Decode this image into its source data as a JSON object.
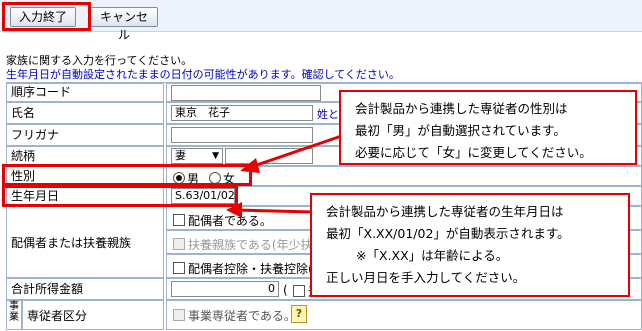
{
  "toolbar": {
    "end_label": "入力終了",
    "cancel_label": "キャンセル"
  },
  "messages": {
    "info": "家族に関する入力を行ってください。",
    "warning": "生年月日が自動設定されたままの日付の可能性があります。確認してください。"
  },
  "fields": {
    "order_code": {
      "label": "順序コード",
      "value": ""
    },
    "name": {
      "label": "氏名",
      "value": "東京　花子",
      "link": "姓と名の"
    },
    "furigana": {
      "label": "フリガナ",
      "value": ""
    },
    "relation": {
      "label": "続柄",
      "value": "妻"
    },
    "gender": {
      "label": "性別",
      "options": [
        "男",
        "女"
      ],
      "selected": "男"
    },
    "birth": {
      "label": "生年月日",
      "value": "S.63/01/02"
    },
    "spouse": {
      "label": "配偶者または扶養親族",
      "options": [
        "配偶者である。",
        "扶養親族である(年少扶養",
        "配偶者控除・扶養控除(与"
      ]
    },
    "income": {
      "label": "合計所得金額",
      "value": "0",
      "suffix": "(",
      "option": "退職"
    },
    "employee": {
      "label_side": "事業",
      "label": "専従者区分",
      "option": "事業専従者である。"
    }
  },
  "callouts": {
    "gender": {
      "line1": "会計製品から連携した専従者の性別は",
      "line2": "最初「男」が自動選択されています。",
      "line3": "必要に応じて「女」に変更してください。"
    },
    "birth": {
      "line1": "会計製品から連携した専従者の生年月日は",
      "line2": "最初「X.XX/01/02」が自動表示されます。",
      "line3": "※「X.XX」は年齢による。",
      "line4": "正しい月日を手入力してください。"
    }
  },
  "colors": {
    "highlight": "#e60000",
    "warning_text": "#0000cc",
    "toolbar_bg": "#eef3fb"
  },
  "icons": {
    "help": "help-icon",
    "relation_dropdown": "chevron-down-icon"
  }
}
